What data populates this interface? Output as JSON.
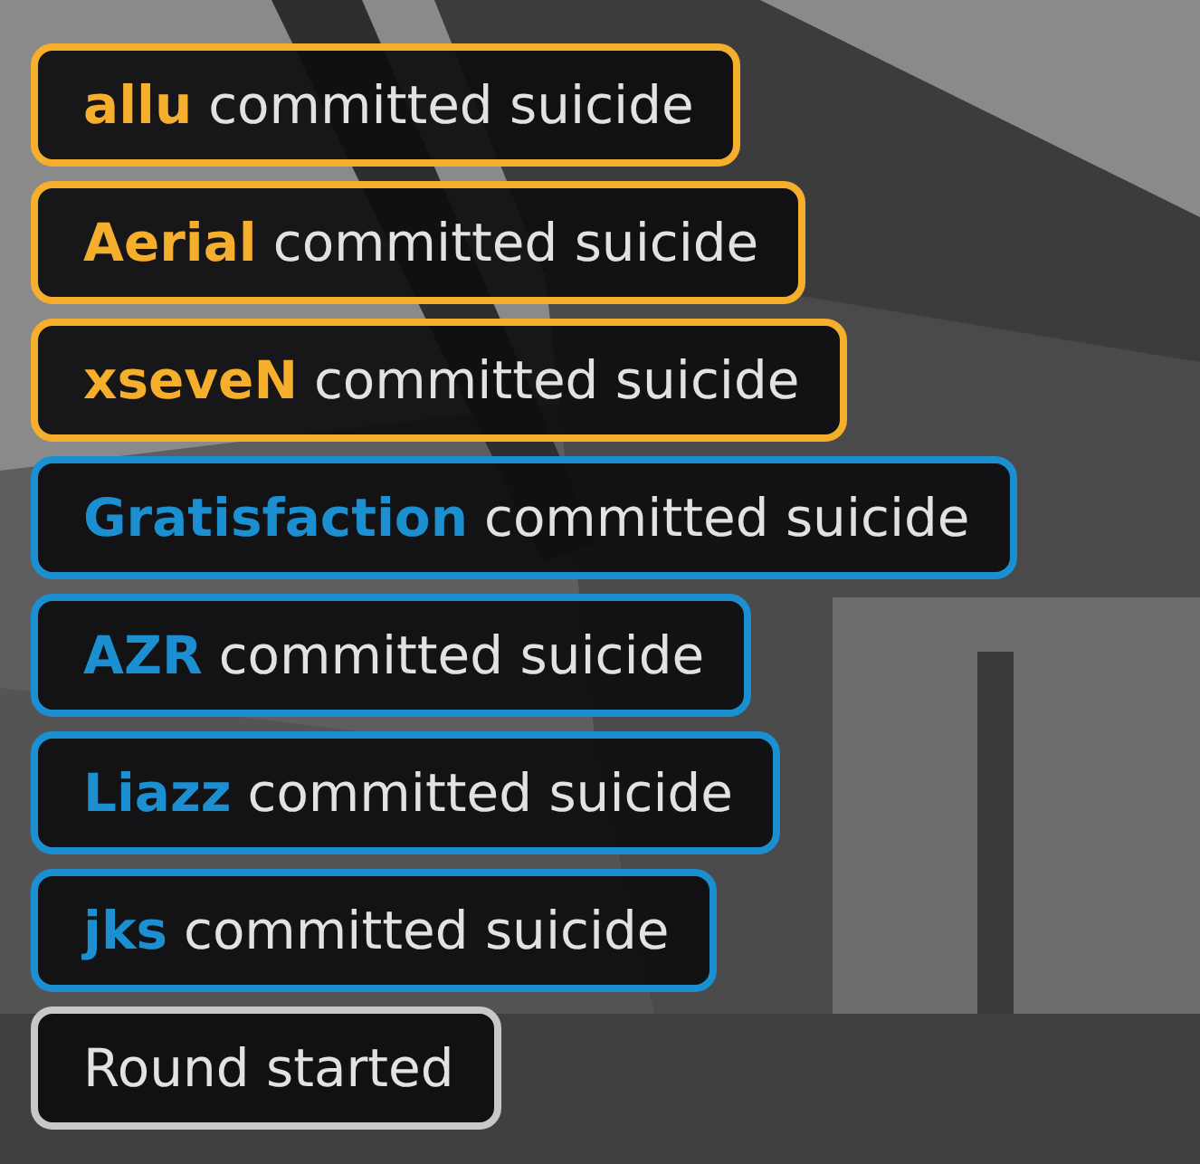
{
  "feed": [
    {
      "kind": "suicide",
      "player": "allu",
      "action": "committed suicide",
      "color": "#f6ae2d"
    },
    {
      "kind": "suicide",
      "player": "Aerial",
      "action": "committed suicide",
      "color": "#f6ae2d"
    },
    {
      "kind": "suicide",
      "player": "xseveN",
      "action": "committed suicide",
      "color": "#f6ae2d"
    },
    {
      "kind": "suicide",
      "player": "Gratisfaction",
      "action": "committed suicide",
      "color": "#1b8fd0"
    },
    {
      "kind": "suicide",
      "player": "AZR",
      "action": "committed suicide",
      "color": "#1b8fd0"
    },
    {
      "kind": "suicide",
      "player": "Liazz",
      "action": "committed suicide",
      "color": "#1b8fd0"
    },
    {
      "kind": "suicide",
      "player": "jks",
      "action": "committed suicide",
      "color": "#1b8fd0"
    },
    {
      "kind": "event",
      "text": "Round started",
      "color": "#c8c8c8"
    }
  ]
}
